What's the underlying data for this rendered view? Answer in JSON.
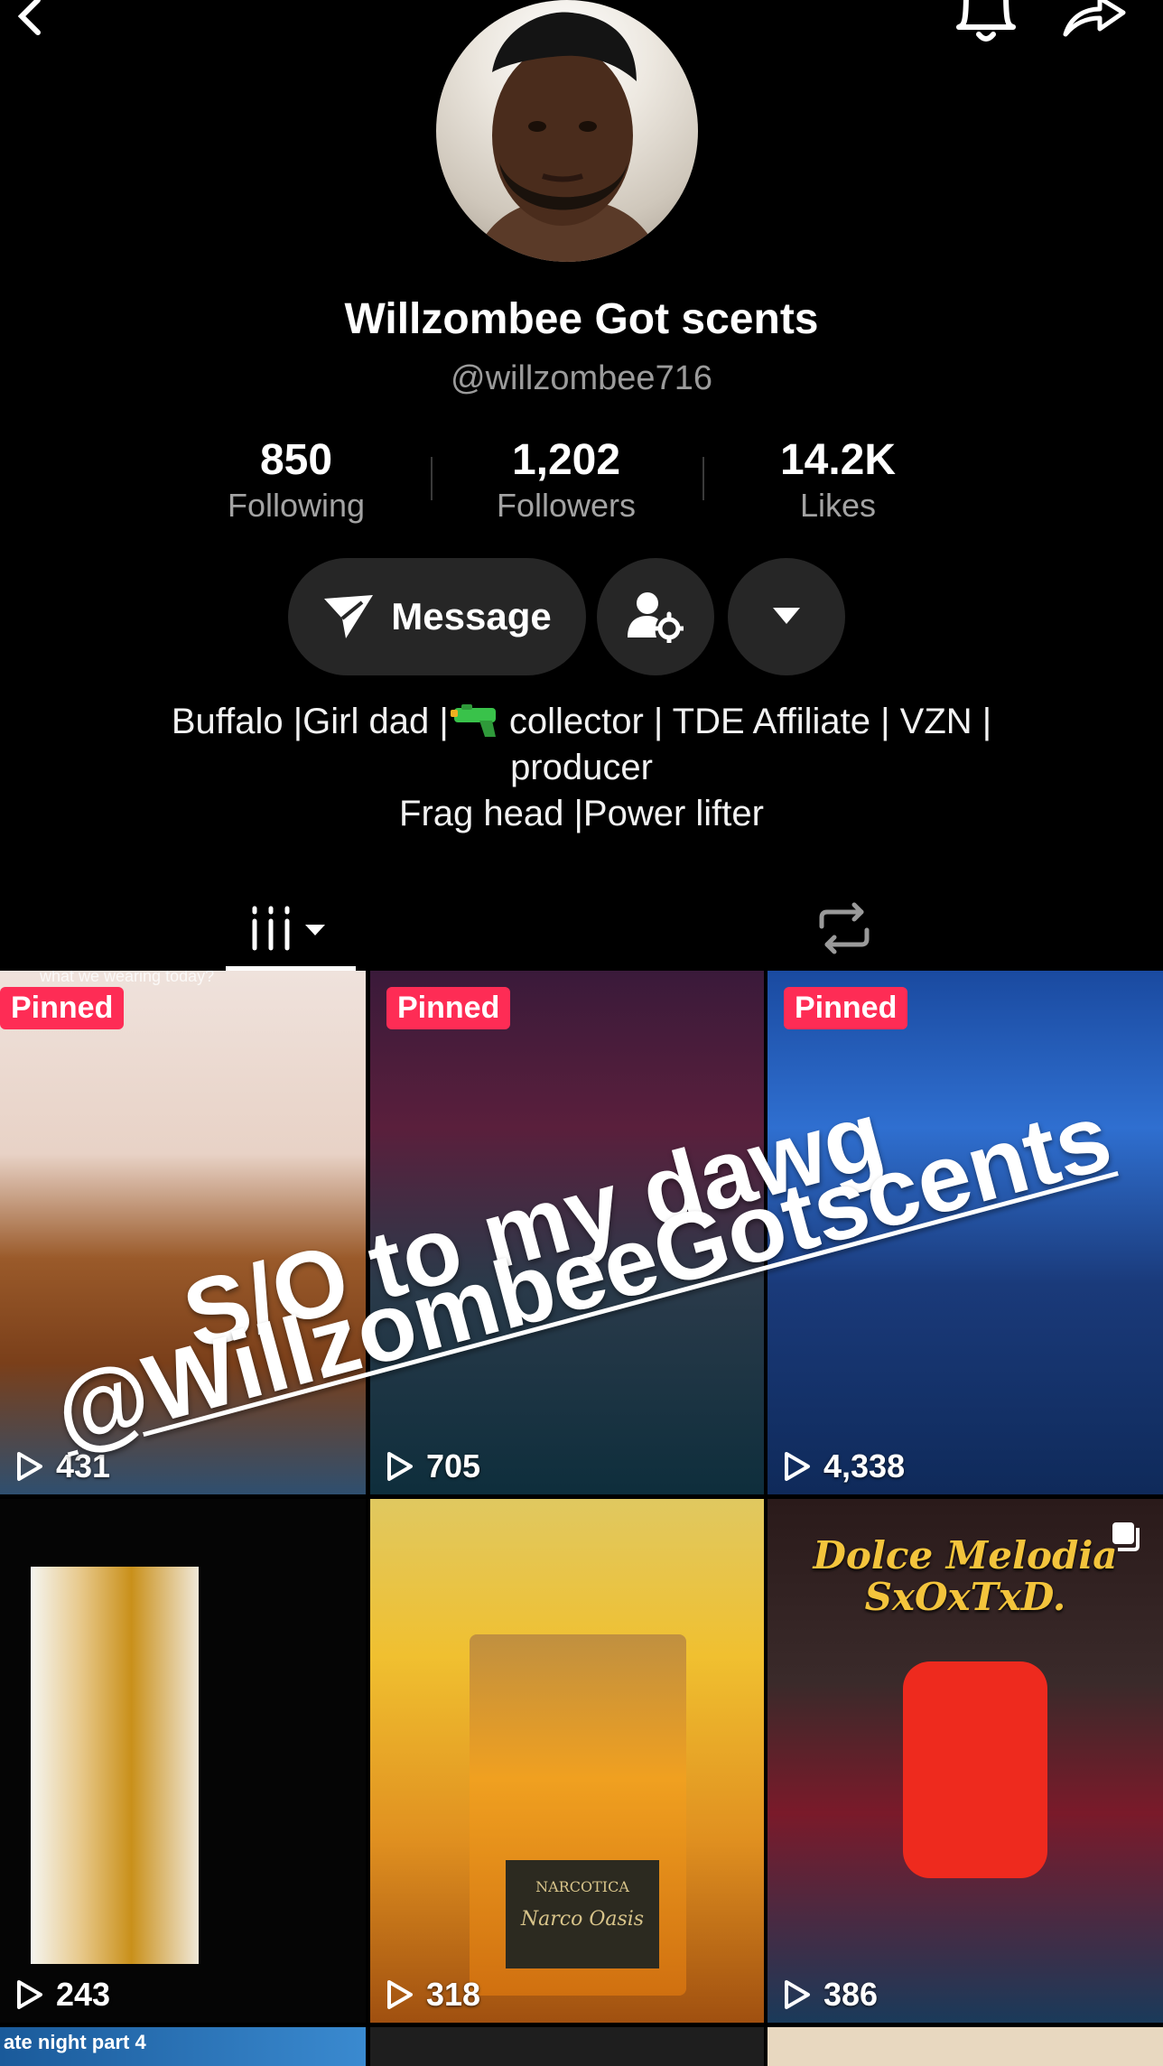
{
  "profile": {
    "display_name": "Willzombee Got scents",
    "username": "@willzombee716",
    "stats": [
      {
        "value": "850",
        "label": "Following"
      },
      {
        "value": "1,202",
        "label": "Followers"
      },
      {
        "value": "14.2K",
        "label": "Likes"
      }
    ],
    "message_label": "Message",
    "bio_line1_a": "Buffalo |Girl dad |",
    "bio_line1_b": " collector | TDE Affiliate | VZN |",
    "bio_line2": "producer",
    "bio_line3": "Frag head |Power lifter",
    "bio_emoji": "water-pistol-icon"
  },
  "icons": {
    "back": "chevron-left-icon",
    "bell": "bell-icon",
    "share": "share-arrow-icon",
    "videos_tab": "grid-icon",
    "repost_tab": "repost-icon"
  },
  "overlay": {
    "line1": "S/O to my dawg",
    "line2": "@WillzombeeGotscents"
  },
  "videos": [
    {
      "pinned": "Pinned",
      "views": "431",
      "caption": "what we wearing today?"
    },
    {
      "pinned": "Pinned",
      "views": "705"
    },
    {
      "pinned": "Pinned",
      "views": "4,338"
    },
    {
      "views": "243"
    },
    {
      "views": "318",
      "label_top": "NARCOTICA",
      "label_bottom": "Narco Oasis"
    },
    {
      "views": "386",
      "title_line1": "Dolce Melodia",
      "title_line2": "SxOxTxD."
    },
    {
      "strip": "ate night part 4"
    },
    {},
    {}
  ],
  "colors": {
    "background": "#000000",
    "button_bg": "#262626",
    "pinned_badge": "#fe2c55",
    "muted_text": "#9b9b9b"
  }
}
